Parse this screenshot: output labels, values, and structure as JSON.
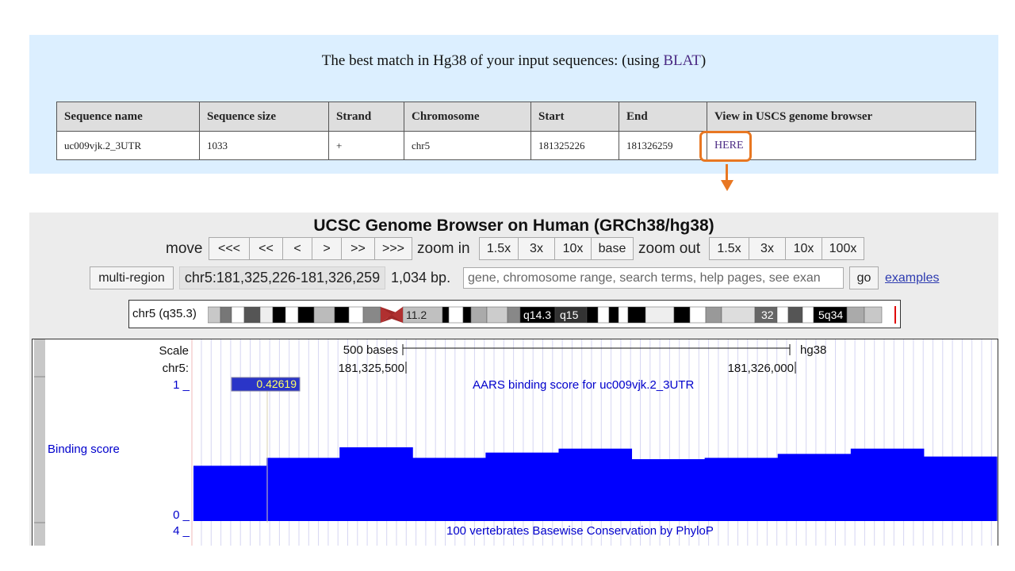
{
  "blat": {
    "heading_prefix": "The best match in Hg38 of your input sequences: (using ",
    "heading_link": "BLAT",
    "heading_suffix": ")",
    "columns": [
      "Sequence name",
      "Sequence size",
      "Strand",
      "Chromosome",
      "Start",
      "End",
      "View in USCS genome browser"
    ],
    "row": {
      "sequence_name": "uc009vjk.2_3UTR",
      "sequence_size": "1033",
      "strand": "+",
      "chromosome": "chr5",
      "start": "181325226",
      "end": "181326259",
      "view_link": "HERE"
    },
    "highlight_color": "#e87722"
  },
  "browser": {
    "title": "UCSC Genome Browser on Human (GRCh38/hg38)",
    "move_label": "move",
    "move_buttons": [
      "<<<",
      "<<",
      "<",
      ">",
      ">>",
      ">>>"
    ],
    "zoom_in_label": "zoom in",
    "zoom_in_buttons": [
      "1.5x",
      "3x",
      "10x",
      "base"
    ],
    "zoom_out_label": "zoom out",
    "zoom_out_buttons": [
      "1.5x",
      "3x",
      "10x",
      "100x"
    ],
    "multi_region": "multi-region",
    "position": "chr5:181,325,226-181,326,259",
    "size": "1,034 bp.",
    "search_placeholder": "gene, chromosome range, search terms, help pages, see exan",
    "go": "go",
    "examples": "examples",
    "ideogram": {
      "label": "chr5 (q35.3)",
      "band_labels": [
        "11.2",
        "q14.3",
        "q15",
        "32",
        "5q34"
      ]
    },
    "tracks": {
      "scale_label": "Scale",
      "chrom_label": "chr5:",
      "scale_text": "500 bases",
      "assembly": "hg38",
      "tick_1": "181,325,500",
      "tick_2": "181,326,000",
      "binding_track_title": "AARS binding score for uc009vjk.2_3UTR",
      "binding_label": "Binding score",
      "y_max": "1 _",
      "y_min": "0 _",
      "hover_value": "0.42619",
      "phylop_y": "4 _",
      "phylop_title": "100 vertebrates Basewise Conservation by PhyloP",
      "bar_color": "#0000ff",
      "binding_values": [
        0.42,
        0.48,
        0.56,
        0.48,
        0.52,
        0.55,
        0.47,
        0.48,
        0.51,
        0.55,
        0.49
      ]
    }
  }
}
